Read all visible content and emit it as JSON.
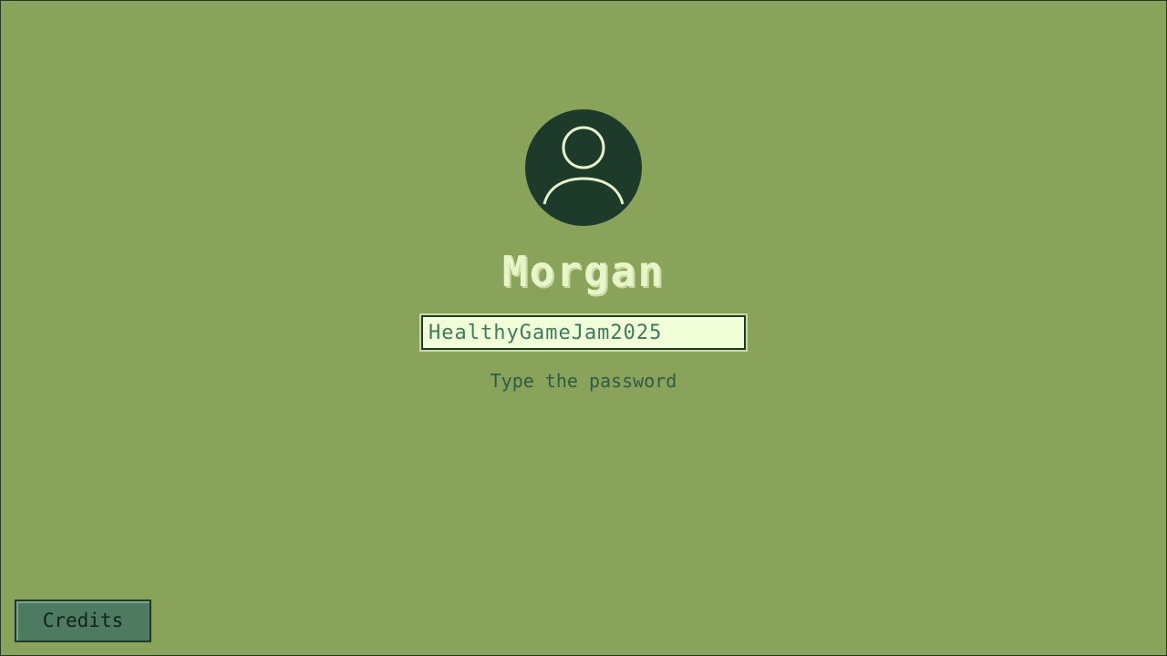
{
  "login": {
    "avatar_icon": "user-icon",
    "username": "Morgan",
    "password_value": "HealthyGameJam2025",
    "hint": "Type the password"
  },
  "footer": {
    "credits_label": "Credits"
  },
  "colors": {
    "background": "#8aa35a",
    "dark": "#1d3a2a",
    "light": "#e8f5c8",
    "button": "#4e7a62"
  }
}
